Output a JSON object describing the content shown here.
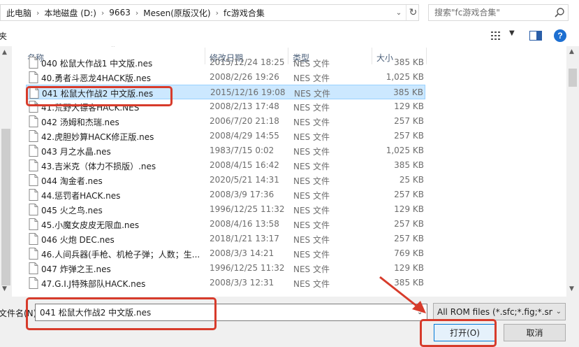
{
  "address": {
    "crumbs": [
      "此电脑",
      "本地磁盘 (D:)",
      "9663",
      "Mesen(原版汉化)",
      "fc游戏合集"
    ]
  },
  "search": {
    "placeholder": "搜索\"fc游戏合集\""
  },
  "toolbar": {
    "left_text": "夹"
  },
  "columns": {
    "name": "名称",
    "date": "修改日期",
    "type": "类型",
    "size": "大小"
  },
  "files": [
    {
      "name": "040 松鼠大作战1 中文版.nes",
      "date": "2015/12/24 18:25",
      "type": "NES 文件",
      "size": "385 KB"
    },
    {
      "name": "40.勇者斗恶龙4HACK版.nes",
      "date": "2008/2/26 19:26",
      "type": "NES 文件",
      "size": "1,025 KB"
    },
    {
      "name": "041 松鼠大作战2 中文版.nes",
      "date": "2015/12/16 19:08",
      "type": "NES 文件",
      "size": "385 KB"
    },
    {
      "name": "41.荒野大镖客HACK.NES",
      "date": "2008/2/13 17:48",
      "type": "NES 文件",
      "size": "129 KB"
    },
    {
      "name": "042 汤姆和杰瑞.nes",
      "date": "2006/7/20 21:18",
      "type": "NES 文件",
      "size": "257 KB"
    },
    {
      "name": "42.虎胆妙算HACK修正版.nes",
      "date": "2008/4/29 14:55",
      "type": "NES 文件",
      "size": "257 KB"
    },
    {
      "name": "043 月之水晶.nes",
      "date": "1983/7/15 0:02",
      "type": "NES 文件",
      "size": "1,025 KB"
    },
    {
      "name": "43.吉米克（体力不损版）.nes",
      "date": "2008/4/15 16:42",
      "type": "NES 文件",
      "size": "385 KB"
    },
    {
      "name": "044 淘金者.nes",
      "date": "2020/5/21 14:31",
      "type": "NES 文件",
      "size": "25 KB"
    },
    {
      "name": "44.惩罚者HACK.nes",
      "date": "2008/3/9 17:36",
      "type": "NES 文件",
      "size": "257 KB"
    },
    {
      "name": "045 火之鸟.nes",
      "date": "1996/12/25 11:32",
      "type": "NES 文件",
      "size": "129 KB"
    },
    {
      "name": "45.小魔女皮皮无限血.nes",
      "date": "2008/4/16 13:58",
      "type": "NES 文件",
      "size": "257 KB"
    },
    {
      "name": "046 火炮 DEC.nes",
      "date": "2018/1/21 13:17",
      "type": "NES 文件",
      "size": "257 KB"
    },
    {
      "name": "46.人间兵器(手枪、机枪子弹；人数；生...",
      "date": "2008/3/3 14:21",
      "type": "NES 文件",
      "size": "769 KB"
    },
    {
      "name": "047 炸弹之王.nes",
      "date": "1996/12/25 11:32",
      "type": "NES 文件",
      "size": "129 KB"
    },
    {
      "name": "47.G.I.J特殊部队HACK.nes",
      "date": "2008/3/3 12:31",
      "type": "NES 文件",
      "size": "385 KB"
    }
  ],
  "selected_index": 2,
  "bottom": {
    "filename_label": "文件名(N):",
    "filename_value": "041 松鼠大作战2 中文版.nes",
    "filter": "All ROM files (*.sfc;*.fig;*.smc",
    "open_label": "打开(O)",
    "cancel_label": "取消"
  },
  "colors": {
    "highlight": "#d73b2b",
    "selection": "#cce8ff",
    "accent": "#0078d7"
  }
}
